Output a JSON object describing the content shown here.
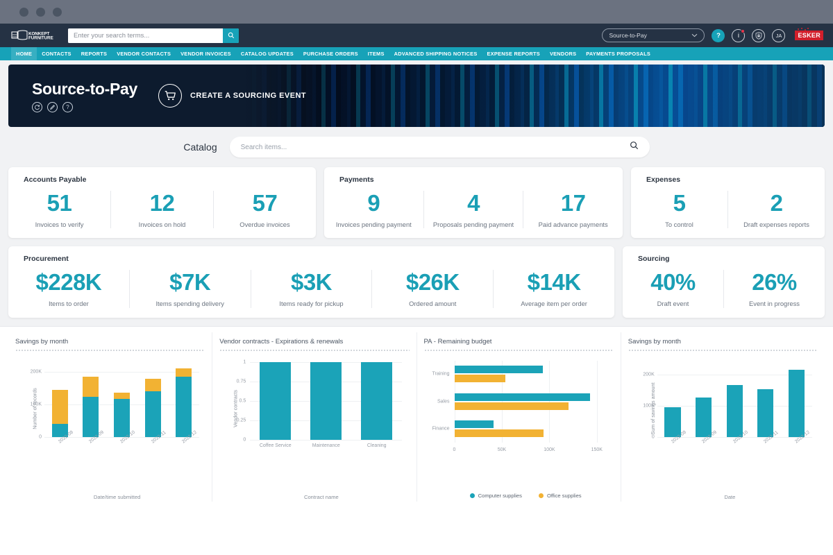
{
  "browser": {
    "dots": 3
  },
  "header": {
    "logo_text_top": "KONKEPT",
    "logo_text_bottom": "FURNITURE",
    "search_placeholder": "Enter your search terms...",
    "search_value": "",
    "search_icon": "search-icon",
    "module_selected": "Source-to-Pay",
    "icons": {
      "help": "?",
      "info": "i",
      "lock": "lock-icon",
      "avatar": "JA"
    },
    "vendor_logo": "ESKER",
    "accent_color": "#17a2b8",
    "bar_color": "#253244",
    "badge_color": "#e8354a"
  },
  "nav": {
    "items": [
      {
        "label": "HOME",
        "active": true
      },
      {
        "label": "CONTACTS",
        "active": false
      },
      {
        "label": "REPORTS",
        "active": false
      },
      {
        "label": "VENDOR CONTACTS",
        "active": false
      },
      {
        "label": "VENDOR INVOICES",
        "active": false
      },
      {
        "label": "CATALOG UPDATES",
        "active": false
      },
      {
        "label": "PURCHASE ORDERS",
        "active": false
      },
      {
        "label": "ITEMS",
        "active": false
      },
      {
        "label": "ADVANCED SHIPPING NOTICES",
        "active": false
      },
      {
        "label": "EXPENSE REPORTS",
        "active": false
      },
      {
        "label": "VENDORS",
        "active": false
      },
      {
        "label": "PAYMENTS PROPOSALS",
        "active": false
      }
    ]
  },
  "hero": {
    "title": "Source-to-Pay",
    "icons": [
      "refresh-icon",
      "edit-icon",
      "help-icon"
    ],
    "action_label": "CREATE A SOURCING EVENT",
    "action_icon": "shopping-cart-icon"
  },
  "catalog": {
    "label": "Catalog",
    "placeholder": "Search items...",
    "value": "",
    "search_icon": "search-icon"
  },
  "kpi_cards": [
    {
      "title": "Accounts Payable",
      "items": [
        {
          "value": "51",
          "label": "Invoices to verify"
        },
        {
          "value": "12",
          "label": "Invoices on hold"
        },
        {
          "value": "57",
          "label": "Overdue invoices"
        }
      ]
    },
    {
      "title": "Payments",
      "items": [
        {
          "value": "9",
          "label": "Invoices pending payment"
        },
        {
          "value": "4",
          "label": "Proposals pending payment"
        },
        {
          "value": "17",
          "label": "Paid advance payments"
        }
      ]
    },
    {
      "title": "Expenses",
      "items": [
        {
          "value": "5",
          "label": "To control"
        },
        {
          "value": "2",
          "label": "Draft expenses reports"
        }
      ]
    },
    {
      "title": "Procurement",
      "items": [
        {
          "value": "$228K",
          "label": "Items to order"
        },
        {
          "value": "$7K",
          "label": "Items spending delivery"
        },
        {
          "value": "$3K",
          "label": "Items ready for pickup"
        },
        {
          "value": "$26K",
          "label": "Ordered amount"
        },
        {
          "value": "$14K",
          "label": "Average item per order"
        }
      ]
    },
    {
      "title": "Sourcing",
      "items": [
        {
          "value": "40%",
          "label": "Draft event"
        },
        {
          "value": "26%",
          "label": "Event in progress"
        }
      ]
    }
  ],
  "kpi_value_color": "#1a9fb5",
  "chart_data": [
    {
      "type": "bar",
      "stacked": true,
      "title": "Savings by month",
      "xlabel": "Date/time submitted",
      "ylabel": "Number of records",
      "categories": [
        "2022-08",
        "2022-09",
        "2022-10",
        "2022-11",
        "2022-12"
      ],
      "yticks": [
        "0",
        "100K",
        "200K"
      ],
      "ylim": [
        0,
        230000
      ],
      "grid": true,
      "legend": "none",
      "series": [
        {
          "name": "teal",
          "color": "#1ba3b8",
          "values": [
            40000,
            122000,
            117000,
            140000,
            185000
          ]
        },
        {
          "name": "yellow",
          "color": "#f2b233",
          "values": [
            105000,
            62000,
            18000,
            38000,
            25000
          ]
        }
      ]
    },
    {
      "type": "bar",
      "stacked": false,
      "title": "Vendor contracts - Expirations & renewals",
      "xlabel": "Contract name",
      "ylabel": "Vendor contracts",
      "categories": [
        "Coffee Service",
        "Maintenance",
        "Cleaning"
      ],
      "yticks": [
        "0",
        "0.25",
        "0.5",
        "0.75",
        "1"
      ],
      "ylim": [
        0,
        1
      ],
      "grid": true,
      "legend": "none",
      "series": [
        {
          "name": "contracts",
          "color": "#1ba3b8",
          "values": [
            1,
            1,
            1
          ]
        }
      ]
    },
    {
      "type": "bar",
      "orientation": "horizontal",
      "title": "PA - Remaining budget",
      "xlabel": "",
      "ylabel": "",
      "categories": [
        "Training",
        "Sales",
        "Finance"
      ],
      "xticks": [
        "0",
        "50K",
        "100K",
        "150K"
      ],
      "xlim": [
        0,
        160000
      ],
      "grid": true,
      "legend": "bottom",
      "series": [
        {
          "name": "Computer supplies",
          "color": "#1ba3b8",
          "values": [
            93000,
            143000,
            41000
          ]
        },
        {
          "name": "Office supplies",
          "color": "#f2b233",
          "values": [
            54000,
            120000,
            94000
          ]
        }
      ]
    },
    {
      "type": "bar",
      "stacked": false,
      "title": "Savings by month",
      "xlabel": "Date",
      "ylabel": "Sum of savings amount",
      "categories": [
        "2022-08",
        "2022-09",
        "2022-10",
        "2022-11",
        "2022-12"
      ],
      "yticks": [
        "0",
        "100K",
        "200K"
      ],
      "ylim": [
        0,
        240000
      ],
      "grid": true,
      "legend": "none",
      "series": [
        {
          "name": "savings",
          "color": "#1ba3b8",
          "values": [
            96000,
            127000,
            166000,
            153000,
            216000
          ]
        }
      ]
    }
  ]
}
